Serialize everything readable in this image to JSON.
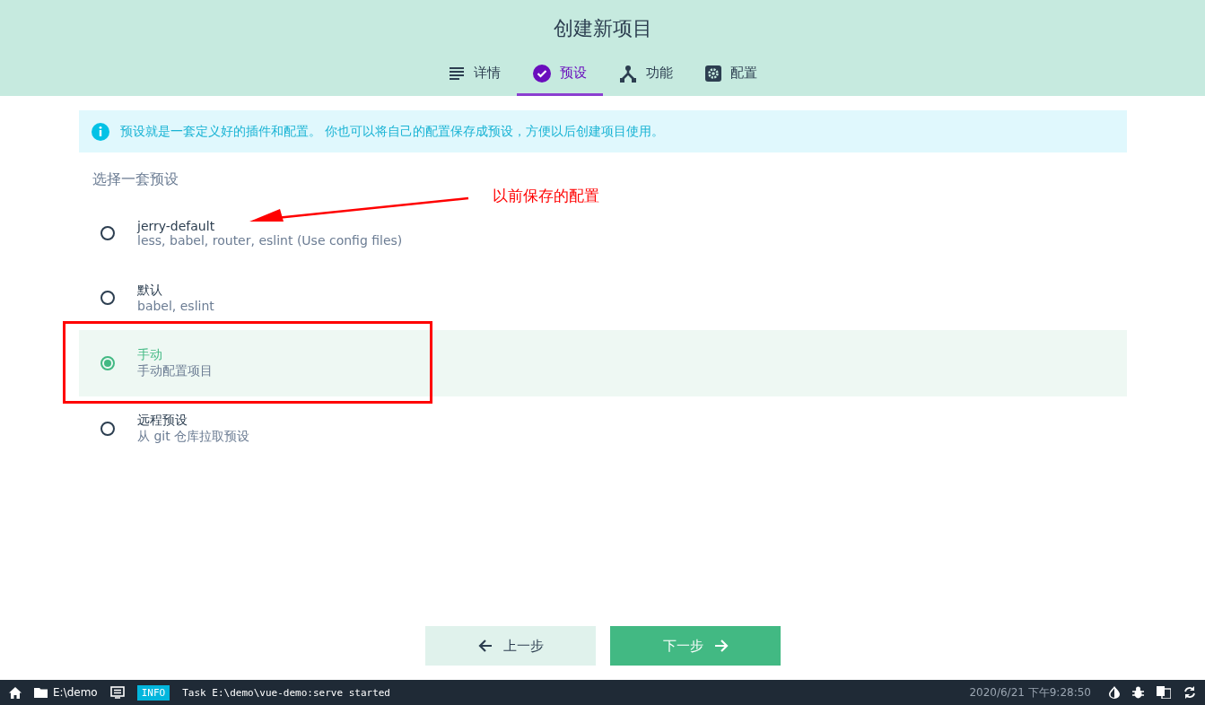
{
  "header": {
    "title": "创建新项目"
  },
  "tabs": [
    {
      "label": "详情",
      "kind": "lines",
      "selected": false
    },
    {
      "label": "预设",
      "kind": "check",
      "selected": true
    },
    {
      "label": "功能",
      "kind": "fork",
      "selected": false
    },
    {
      "label": "配置",
      "kind": "gear",
      "selected": false
    }
  ],
  "info_banner": {
    "text": "预设就是一套定义好的插件和配置。 你也可以将自己的配置保存成预设，方便以后创建项目使用。"
  },
  "section_title": "选择一套预设",
  "presets": [
    {
      "name": "jerry-default",
      "description": "less, babel, router, eslint (Use config files)",
      "selected": false
    },
    {
      "name": "默认",
      "description": "babel, eslint",
      "selected": false
    },
    {
      "name": "手动",
      "description": "手动配置项目",
      "selected": true
    },
    {
      "name": "远程预设",
      "description": "从 git 仓库拉取预设",
      "selected": false
    }
  ],
  "annotation": {
    "text": "以前保存的配置"
  },
  "buttons": {
    "back": "上一步",
    "next": "下一步"
  },
  "status_bar": {
    "folder": "E:\\demo",
    "log_level": "INFO",
    "log_message": "Task E:\\demo\\vue-demo:serve started",
    "datetime": "2020/6/21 下午9:28:50"
  }
}
